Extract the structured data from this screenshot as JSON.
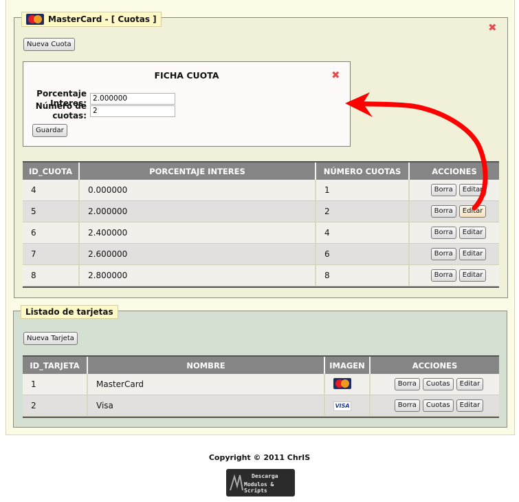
{
  "cuotas_panel": {
    "legend": "MasterCard - [ Cuotas ]",
    "close_glyph": "✖",
    "new_button": "Nueva Cuota",
    "icon": "mastercard-logo"
  },
  "ficha": {
    "title": "FICHA CUOTA",
    "close_glyph": "✖",
    "porcentaje_label": "Porcentaje Interes:",
    "porcentaje_value": "2.000000",
    "numero_label": "Número de cuotas:",
    "numero_value": "2",
    "save_button": "Guardar"
  },
  "cuotas_table": {
    "headers": [
      "ID_CUOTA",
      "PORCENTAJE INTERES",
      "NÚMERO CUOTAS",
      "ACCIONES"
    ],
    "rows": [
      {
        "id": "4",
        "porcentaje": "0.000000",
        "numero": "1"
      },
      {
        "id": "5",
        "porcentaje": "2.000000",
        "numero": "2"
      },
      {
        "id": "6",
        "porcentaje": "2.400000",
        "numero": "4"
      },
      {
        "id": "7",
        "porcentaje": "2.600000",
        "numero": "6"
      },
      {
        "id": "8",
        "porcentaje": "2.800000",
        "numero": "8"
      }
    ],
    "borra_label": "Borra",
    "editar_label": "Editar"
  },
  "tarjetas_panel": {
    "legend": "Listado de tarjetas",
    "new_button": "Nueva Tarjeta"
  },
  "tarjetas_table": {
    "headers": [
      "ID_TARJETA",
      "NOMBRE",
      "IMAGEN",
      "ACCIONES"
    ],
    "rows": [
      {
        "id": "1",
        "nombre": "MasterCard",
        "imagen": "mastercard-logo"
      },
      {
        "id": "2",
        "nombre": "Visa",
        "imagen": "visa-logo"
      }
    ],
    "borra_label": "Borra",
    "cuotas_label": "Cuotas",
    "editar_label": "Editar",
    "visa_text": "VISA"
  },
  "footer": {
    "copyright": "Copyright © 2011 ChrIS",
    "badge_line1": "Descarga",
    "badge_line2": "Modulos & Scripts"
  },
  "colors": {
    "annotation_arrow": "#ff0000",
    "close_icon": "#e05050",
    "header_bg": "#858585"
  }
}
